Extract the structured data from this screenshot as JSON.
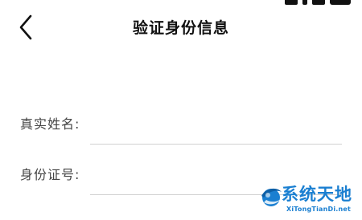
{
  "header": {
    "title": "验证身份信息"
  },
  "icons": {
    "back": "chevron-left-icon",
    "watermark_logo": "globe-swirl-icon"
  },
  "form": {
    "name_label": "真实姓名:",
    "name_value": "",
    "id_label": "身份证号:",
    "id_value": ""
  },
  "watermark": {
    "brand": "系统天地",
    "url": "XiTongTianDi.net"
  },
  "colors": {
    "background": "#ffffff",
    "text": "#222222",
    "underline": "#d0d0d0",
    "watermark_blue": "#1a7fd1"
  }
}
